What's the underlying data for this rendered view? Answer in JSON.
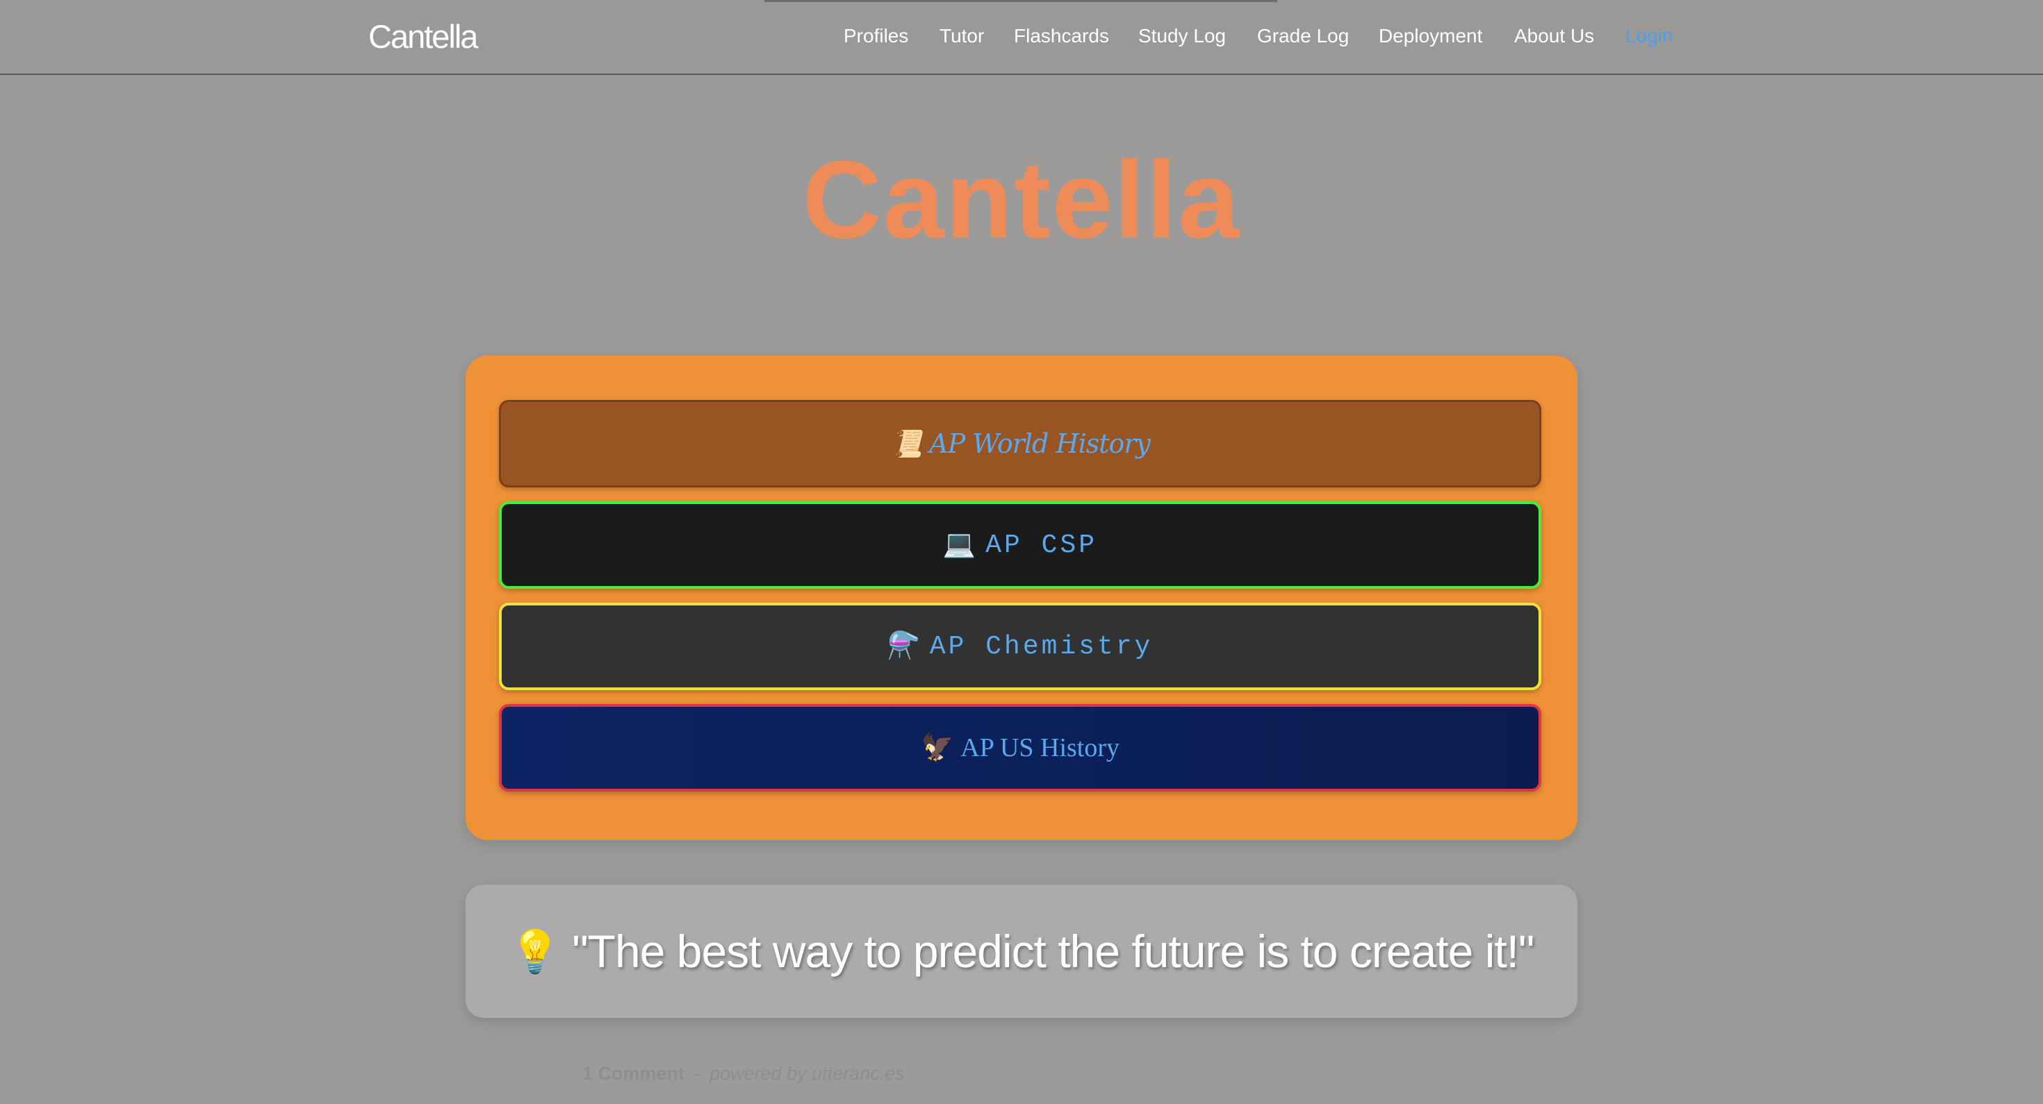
{
  "header": {
    "brand": "Cantella",
    "nav": [
      {
        "label": "Profiles"
      },
      {
        "label": "Tutor"
      },
      {
        "label": "Flashcards"
      },
      {
        "label": "Study Log"
      },
      {
        "label": "Grade Log"
      },
      {
        "label": "Deployment"
      },
      {
        "label": "About Us"
      },
      {
        "label": "Login"
      }
    ]
  },
  "hero": {
    "title": "Cantella"
  },
  "courses": [
    {
      "icon": "📜",
      "icon_name": "scroll-icon",
      "label": "AP World History"
    },
    {
      "icon": "💻",
      "icon_name": "laptop-icon",
      "label": "AP CSP"
    },
    {
      "icon": "⚗️",
      "icon_name": "flask-icon",
      "label": "AP Chemistry"
    },
    {
      "icon": "🦅",
      "icon_name": "eagle-icon",
      "label": "AP US History"
    }
  ],
  "quote": {
    "icon": "💡",
    "icon_name": "lightbulb-icon",
    "text": "\"The best way to predict the future is to create it!\""
  },
  "comments": {
    "count_label": "1 Comment",
    "separator": "-",
    "powered_by": "powered by utteranc.es"
  },
  "colors": {
    "page_background": "#9c9b99",
    "title_accent": "#ef8b59",
    "panel_background": "#ef9137",
    "link_color": "#5aa8ee",
    "login_color": "#4b9ff2",
    "world_history_bg": "#995424",
    "csp_bg": "#1b1b1b",
    "csp_border": "#44ee3a",
    "chemistry_bg": "#323232",
    "chemistry_border": "#ece23c",
    "us_history_bg": "#0c2464",
    "us_history_border": "#e03344"
  }
}
